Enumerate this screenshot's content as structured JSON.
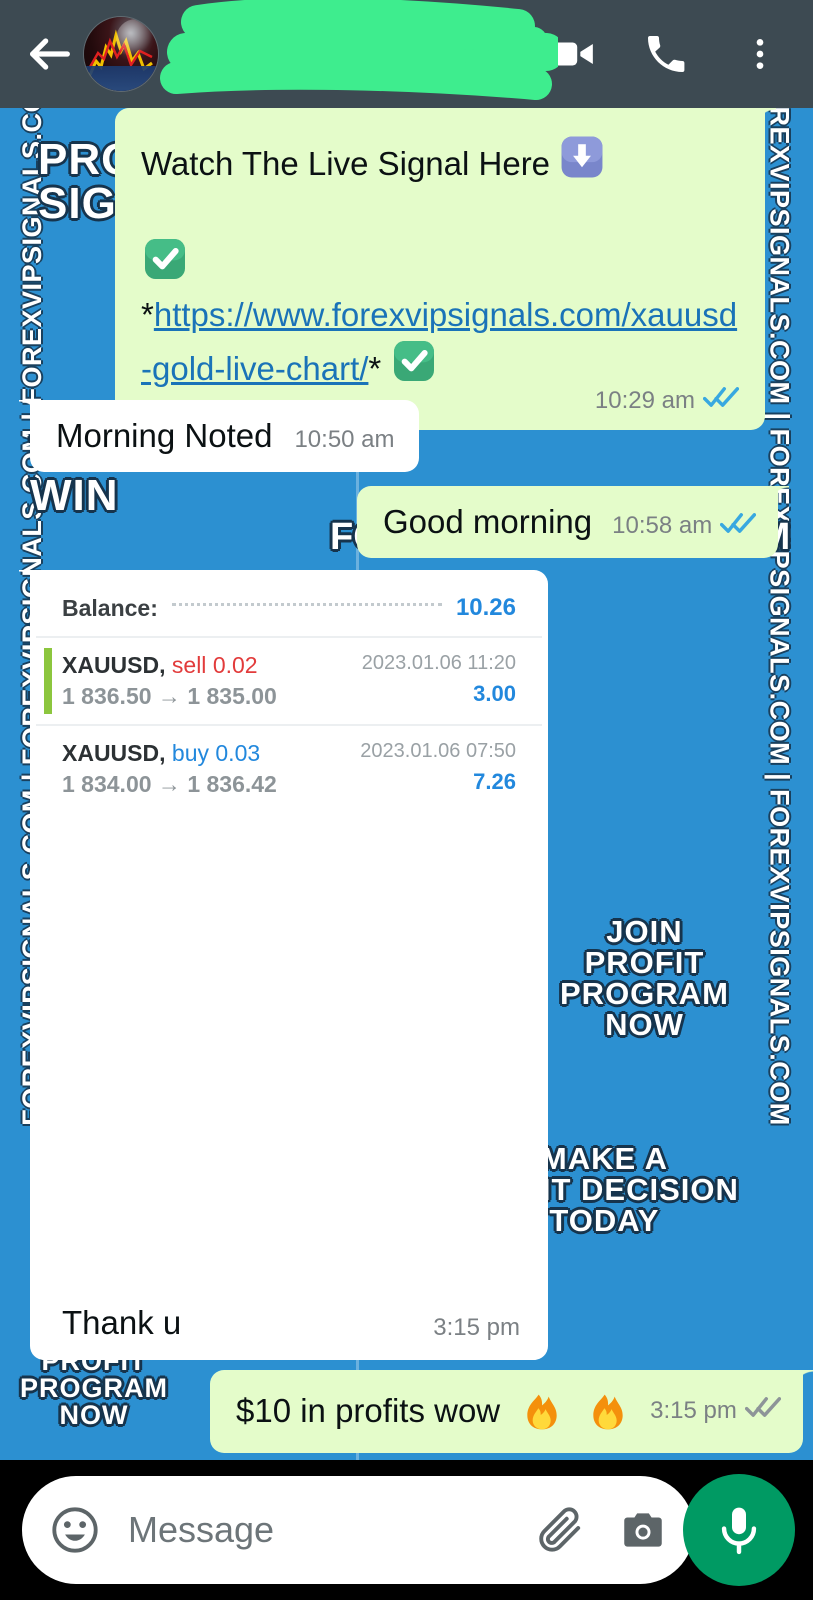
{
  "header": {
    "back_icon": "back-arrow-icon",
    "avatar_icon": "contact-avatar",
    "contact_name": "",
    "contact_status": "",
    "redaction": "green-scribble-redaction",
    "video_icon": "video-call-icon",
    "call_icon": "voice-call-icon",
    "menu_icon": "overflow-menu-icon",
    "bg_color": "#3d4a52",
    "scribble_color": "#3eed8e"
  },
  "wallpaper": {
    "bg_color": "#2c90d1",
    "side_text_left": "FOREXVIPSIGNALS.COM | FOREXVIPSIGNALS.COM | FOREXVIPSIGNALS.COM",
    "side_text_right": "FOREXVIPSIGNALS.COM | FOREXVIPSIGNALS.COM | FOREXVIPSIGNALS.COM",
    "word_profit_signals": "PROFIT\nSIGNALS",
    "word_to_win": "TO\nWIN",
    "word_center_brand": "FOREXVIPSIGNALS.COM",
    "word_join": "JOIN\nPROFIT\nPROGRAM\nNOW",
    "word_make": "MAKE A\nRIGHT DECISION\nTODAY",
    "word_profit_program": "PROFIT\nPROGRAM\nNOW",
    "share_icon": "share-forward-icon"
  },
  "messages": [
    {
      "id": "msg-link",
      "direction": "outgoing",
      "line1": "Watch The Live Signal Here",
      "line1_emoji": "down-arrow-emoji",
      "check_emoji": "white-check-mark-emoji",
      "link_prefix": "*",
      "link_text": "https://www.forexvipsignals.com/xauusd-gold-live-chart/",
      "link_suffix": "*",
      "time": "10:29 am",
      "status": "read",
      "tick_icon": "double-check-blue-icon"
    },
    {
      "id": "msg-morning-noted",
      "direction": "incoming",
      "text": "Morning Noted",
      "time": "10:50 am",
      "status": "none"
    },
    {
      "id": "msg-good-morning",
      "direction": "outgoing",
      "text": "Good morning",
      "time": "10:58 am",
      "status": "read",
      "tick_icon": "double-check-blue-icon"
    },
    {
      "id": "msg-trade",
      "direction": "incoming",
      "attachment": "trade-history-screenshot",
      "text": "Thank u",
      "time": "3:15 pm",
      "status": "none"
    },
    {
      "id": "msg-profits",
      "direction": "outgoing",
      "text": "$10 in profits wow",
      "emoji1": "fire-emoji",
      "emoji2": "fire-emoji",
      "time": "3:15 pm",
      "status": "delivered",
      "tick_icon": "double-check-grey-icon"
    }
  ],
  "trade_card": {
    "balance_label": "Balance:",
    "balance_value": "10.26",
    "rows": [
      {
        "symbol": "XAUUSD,",
        "side": "sell",
        "volume": "0.02",
        "price_open": "1 836.50",
        "arrow": "→",
        "price_close": "1 835.00",
        "datetime": "2023.01.06 11:20",
        "profit": "3.00",
        "side_color": "#e23b3b",
        "bar_color": "#8cc63e"
      },
      {
        "symbol": "XAUUSD,",
        "side": "buy",
        "volume": "0.03",
        "price_open": "1 834.00",
        "arrow": "→",
        "price_close": "1 836.42",
        "datetime": "2023.01.06 07:50",
        "profit": "7.26",
        "side_color": "#2288dd",
        "bar_color": "#8cc63e"
      }
    ]
  },
  "input_bar": {
    "emoji_icon": "emoji-smiley-icon",
    "placeholder": "Message",
    "attach_icon": "paperclip-icon",
    "camera_icon": "camera-icon",
    "mic_icon": "microphone-icon",
    "mic_bg": "#009a63"
  },
  "colors": {
    "outgoing_bubble": "#e4fcca",
    "incoming_bubble": "#ffffff",
    "link": "#1a73b8",
    "tick_blue": "#38a8e0",
    "tick_grey": "#8d9498"
  }
}
